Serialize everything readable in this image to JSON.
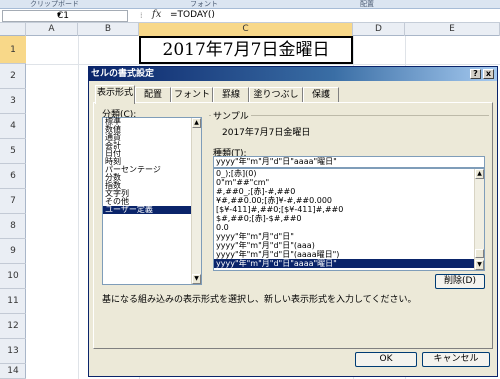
{
  "ribbon": {
    "groups": [
      "クリップボード",
      "フォント",
      "配置"
    ]
  },
  "formula_bar": {
    "name_box": "C1",
    "fx": "fx",
    "formula": "=TODAY()"
  },
  "columns": [
    "A",
    "B",
    "C",
    "D",
    "E"
  ],
  "rows": [
    "1",
    "2",
    "3",
    "4",
    "5",
    "6",
    "7",
    "8",
    "9",
    "10",
    "11",
    "12",
    "13",
    "14"
  ],
  "cell_c1": "2017年7月7日金曜日",
  "dialog": {
    "title": "セルの書式設定",
    "help": "?",
    "close": "x",
    "tabs": [
      "表示形式",
      "配置",
      "フォント",
      "罫線",
      "塗りつぶし",
      "保護"
    ],
    "category_label": "分類(C):",
    "categories": [
      "標準",
      "数値",
      "通貨",
      "会計",
      "日付",
      "時刻",
      "パーセンテージ",
      "分数",
      "指数",
      "文字列",
      "その他",
      "ユーザー定義"
    ],
    "selected_category": "ユーザー定義",
    "sample_label": "サンプル",
    "sample_value": "2017年7月7日金曜日",
    "type_label": "種類(T):",
    "type_value": "yyyy\"年\"m\"月\"d\"日\"aaaa\"曜日\"",
    "formats": [
      "0_);[赤](0)",
      "0\"m\"##\"cm\"",
      "#,##0_;[赤]-#,##0",
      "¥#,##0.00;[赤]¥-#,##0.000",
      "[$¥-411]#,##0;[$¥-411]#,##0",
      "$#,##0;[赤]-$#,##0",
      "0.0",
      "yyyy\"年\"m\"月\"d\"日\"",
      "yyyy\"年\"m\"月\"d\"日\"(aaa)",
      "yyyy\"年\"m\"月\"d\"日\"(aaaa曜日\")",
      "yyyy\"年\"m\"月\"d\"日\"aaaa\"曜日\""
    ],
    "delete_button": "削除(D)",
    "description": "基になる組み込みの表示形式を選択し、新しい表示形式を入力してください。",
    "ok_button": "OK",
    "cancel_button": "キャンセル"
  }
}
